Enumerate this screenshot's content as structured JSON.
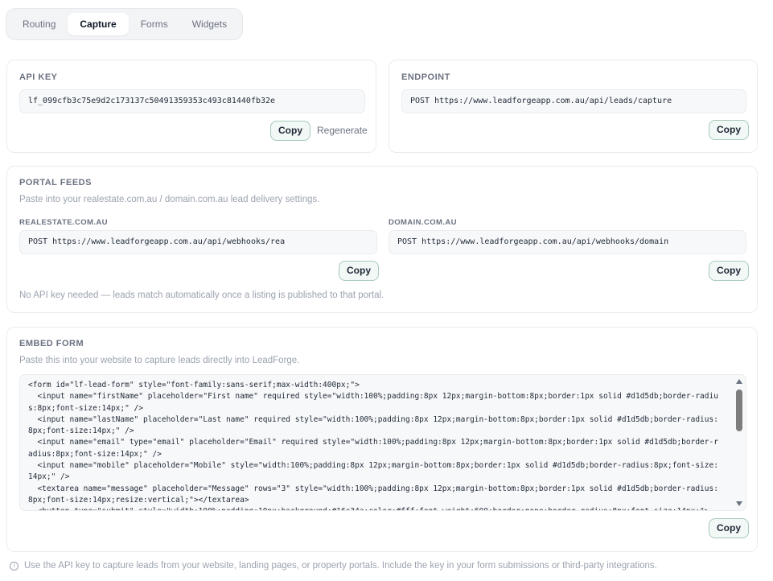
{
  "tabs": [
    {
      "label": "Routing",
      "active": false
    },
    {
      "label": "Capture",
      "active": true
    },
    {
      "label": "Forms",
      "active": false
    },
    {
      "label": "Widgets",
      "active": false
    }
  ],
  "api_key": {
    "title": "API KEY",
    "value": "lf_099cfb3c75e9d2c173137c50491359353c493c81440fb32e",
    "copy_label": "Copy",
    "regenerate_label": "Regenerate"
  },
  "endpoint": {
    "title": "ENDPOINT",
    "value": "POST https://www.leadforgeapp.com.au/api/leads/capture",
    "copy_label": "Copy"
  },
  "portal_feeds": {
    "title": "PORTAL FEEDS",
    "description": "Paste into your realestate.com.au / domain.com.au lead delivery settings.",
    "realestate": {
      "label": "REALESTATE.COM.AU",
      "value": "POST https://www.leadforgeapp.com.au/api/webhooks/rea",
      "copy_label": "Copy"
    },
    "domain": {
      "label": "DOMAIN.COM.AU",
      "value": "POST https://www.leadforgeapp.com.au/api/webhooks/domain",
      "copy_label": "Copy"
    },
    "note": "No API key needed — leads match automatically once a listing is published to that portal."
  },
  "embed_form": {
    "title": "EMBED FORM",
    "description": "Paste this into your website to capture leads directly into LeadForge.",
    "code": "<form id=\"lf-lead-form\" style=\"font-family:sans-serif;max-width:400px;\">\n  <input name=\"firstName\" placeholder=\"First name\" required style=\"width:100%;padding:8px 12px;margin-bottom:8px;border:1px solid #d1d5db;border-radius:8px;font-size:14px;\" />\n  <input name=\"lastName\" placeholder=\"Last name\" required style=\"width:100%;padding:8px 12px;margin-bottom:8px;border:1px solid #d1d5db;border-radius:8px;font-size:14px;\" />\n  <input name=\"email\" type=\"email\" placeholder=\"Email\" required style=\"width:100%;padding:8px 12px;margin-bottom:8px;border:1px solid #d1d5db;border-radius:8px;font-size:14px;\" />\n  <input name=\"mobile\" placeholder=\"Mobile\" style=\"width:100%;padding:8px 12px;margin-bottom:8px;border:1px solid #d1d5db;border-radius:8px;font-size:14px;\" />\n  <textarea name=\"message\" placeholder=\"Message\" rows=\"3\" style=\"width:100%;padding:8px 12px;margin-bottom:8px;border:1px solid #d1d5db;border-radius:8px;font-size:14px;resize:vertical;\"></textarea>\n  <button type=\"submit\" style=\"width:100%;padding:10px;background:#16a34a;color:#fff;font-weight:600;border:none;border-radius:8px;font-size:14px;\">",
    "copy_label": "Copy"
  },
  "footer_note": "Use the API key to capture leads from your website, landing pages, or property portals. Include the key in your form submissions or third-party integrations."
}
